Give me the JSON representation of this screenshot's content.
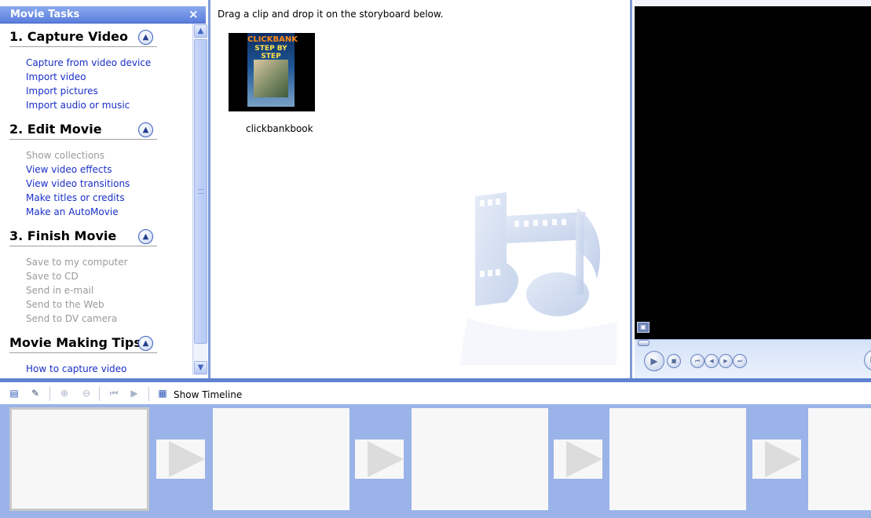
{
  "task_pane": {
    "title": "Movie Tasks",
    "close_glyph": "×",
    "sections": [
      {
        "title": "1. Capture Video",
        "links": [
          {
            "label": "Capture from video device",
            "enabled": true
          },
          {
            "label": "Import video",
            "enabled": true
          },
          {
            "label": "Import pictures",
            "enabled": true
          },
          {
            "label": "Import audio or music",
            "enabled": true
          }
        ]
      },
      {
        "title": "2. Edit Movie",
        "links": [
          {
            "label": "Show collections",
            "enabled": false
          },
          {
            "label": "View video effects",
            "enabled": true
          },
          {
            "label": "View video transitions",
            "enabled": true
          },
          {
            "label": "Make titles or credits",
            "enabled": true
          },
          {
            "label": "Make an AutoMovie",
            "enabled": true
          }
        ]
      },
      {
        "title": "3. Finish Movie",
        "links": [
          {
            "label": "Save to my computer",
            "enabled": false
          },
          {
            "label": "Save to CD",
            "enabled": false
          },
          {
            "label": "Send in e-mail",
            "enabled": false
          },
          {
            "label": "Send to the Web",
            "enabled": false
          },
          {
            "label": "Send to DV camera",
            "enabled": false
          }
        ]
      },
      {
        "title": "Movie Making Tips",
        "links": [
          {
            "label": "How to capture video",
            "enabled": true
          }
        ]
      }
    ]
  },
  "collection": {
    "hint": "Drag a clip and drop it on the storyboard below.",
    "clips": [
      {
        "name": "clickbankbook",
        "cover_line1": "CLICKBANK",
        "cover_line2": "STEP BY STEP"
      }
    ]
  },
  "monitor": {
    "icons": [
      "fullscreen-icon",
      "seek-knob",
      "play-icon",
      "stop-icon",
      "back-icon",
      "previous-frame-icon",
      "next-frame-icon",
      "forward-icon",
      "split-icon"
    ]
  },
  "storyboard_toolbar": {
    "show_timeline_label": "Show Timeline",
    "icons": [
      "set-audio-levels-icon",
      "narrate-icon",
      "zoom-in-icon",
      "zoom-out-icon",
      "rewind-storyboard-icon",
      "play-storyboard-icon",
      "show-timeline-icon"
    ]
  },
  "storyboard": {
    "frame_count": 5,
    "transition_count": 4
  },
  "colors": {
    "task_header": "#5a7edc",
    "link_enabled": "#1a2fc6",
    "link_disabled": "#9a9a9a",
    "storyboard_bg": "#9ab3e8",
    "pane_border": "#7f9bd8"
  }
}
